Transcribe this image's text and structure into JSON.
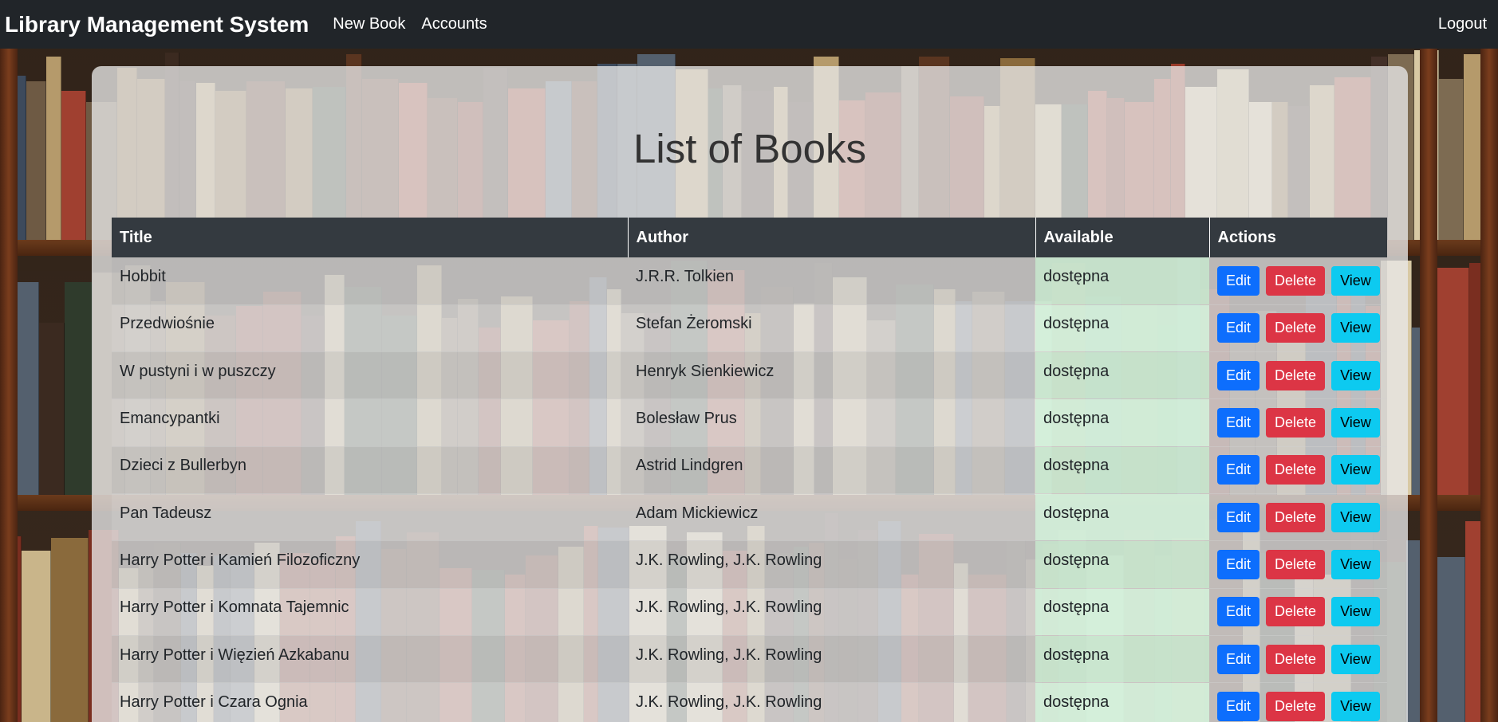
{
  "navbar": {
    "brand": "Library Management System",
    "links": [
      "New Book",
      "Accounts"
    ],
    "logout": "Logout"
  },
  "page": {
    "title": "List of Books"
  },
  "table": {
    "headers": [
      "Title",
      "Author",
      "Available",
      "Actions"
    ],
    "actions": {
      "edit": "Edit",
      "delete": "Delete",
      "view": "View"
    },
    "rows": [
      {
        "title": "Hobbit",
        "author": "J.R.R. Tolkien",
        "available": "dostępna"
      },
      {
        "title": "Przedwiośnie",
        "author": "Stefan Żeromski",
        "available": "dostępna"
      },
      {
        "title": "W pustyni i w puszczy",
        "author": "Henryk Sienkiewicz",
        "available": "dostępna"
      },
      {
        "title": "Emancypantki",
        "author": "Bolesław Prus",
        "available": "dostępna"
      },
      {
        "title": "Dzieci z Bullerbyn",
        "author": "Astrid Lindgren",
        "available": "dostępna"
      },
      {
        "title": "Pan Tadeusz",
        "author": "Adam Mickiewicz",
        "available": "dostępna"
      },
      {
        "title": "Harry Potter i Kamień Filozoficzny",
        "author": "J.K. Rowling, J.K. Rowling",
        "available": "dostępna"
      },
      {
        "title": "Harry Potter i Komnata Tajemnic",
        "author": "J.K. Rowling, J.K. Rowling",
        "available": "dostępna"
      },
      {
        "title": "Harry Potter i Więzień Azkabanu",
        "author": "J.K. Rowling, J.K. Rowling",
        "available": "dostępna"
      },
      {
        "title": "Harry Potter i Czara Ognia",
        "author": "J.K. Rowling, J.K. Rowling",
        "available": "dostępna"
      }
    ]
  },
  "colors": {
    "navbar": "#212529",
    "table_header": "#343a40",
    "edit": "#0d6efd",
    "delete": "#dc3545",
    "view": "#0dcaf0",
    "available_cell": "#d1e7dd"
  }
}
